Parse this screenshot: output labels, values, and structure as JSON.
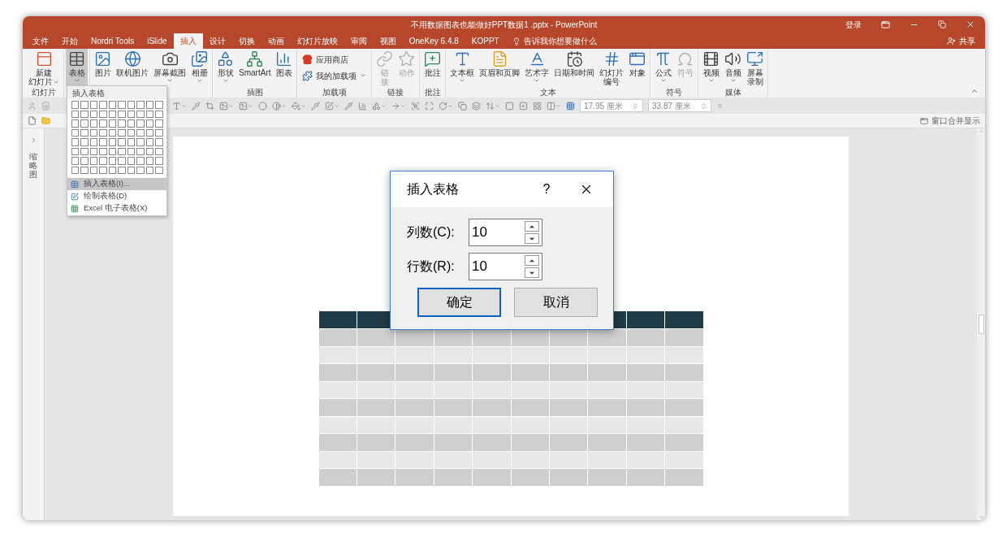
{
  "window": {
    "title": "不用数据图表也能做好PPT数据1 .pptx - PowerPoint",
    "sign_in": "登录",
    "share": "共享"
  },
  "tabs": [
    {
      "label": "文件",
      "selected": false
    },
    {
      "label": "开始",
      "selected": false
    },
    {
      "label": "Nordri Tools",
      "selected": false
    },
    {
      "label": "iSlide",
      "selected": false
    },
    {
      "label": "插入",
      "selected": true
    },
    {
      "label": "设计",
      "selected": false
    },
    {
      "label": "切换",
      "selected": false
    },
    {
      "label": "动画",
      "selected": false
    },
    {
      "label": "幻灯片放映",
      "selected": false
    },
    {
      "label": "审阅",
      "selected": false
    },
    {
      "label": "视图",
      "selected": false
    },
    {
      "label": "OneKey 6.4.8",
      "selected": false
    },
    {
      "label": "KOPPT",
      "selected": false
    }
  ],
  "tell_me": "告诉我你想要做什么",
  "ribbon": {
    "groups": [
      {
        "label": "幻灯片",
        "buttons": [
          {
            "kind": "large",
            "label": "新建",
            "label_2": "幻灯片",
            "menu": true,
            "disabled": false,
            "pressed": false
          }
        ]
      },
      {
        "buttons": [
          {
            "kind": "large",
            "label": "表格",
            "menu": true,
            "disabled": false,
            "pressed": true
          }
        ]
      },
      {
        "buttons": [
          {
            "kind": "large",
            "label": "图片",
            "menu": false,
            "disabled": false,
            "pressed": false
          },
          {
            "kind": "large",
            "label": "联机图片",
            "menu": false,
            "disabled": false,
            "pressed": false
          },
          {
            "kind": "large",
            "label": "屏幕截图",
            "menu": true,
            "disabled": false,
            "pressed": false
          },
          {
            "kind": "large",
            "label": "相册",
            "menu": true,
            "disabled": false,
            "pressed": false
          }
        ]
      },
      {
        "label": "插图",
        "buttons": [
          {
            "kind": "large",
            "label": "形状",
            "menu": true,
            "disabled": false,
            "pressed": false
          },
          {
            "kind": "large",
            "label": "SmartArt",
            "menu": false,
            "disabled": false,
            "pressed": false
          },
          {
            "kind": "large",
            "label": "图表",
            "menu": false,
            "disabled": false,
            "pressed": false
          }
        ]
      },
      {
        "label": "加载项",
        "buttons": [
          {
            "kind": "small",
            "label": "应用商店",
            "menu": false,
            "disabled": false,
            "pressed": false
          },
          {
            "kind": "small",
            "label": "我的加载项",
            "menu": true,
            "disabled": false,
            "pressed": false
          }
        ]
      },
      {
        "label": "链接",
        "buttons": [
          {
            "kind": "large",
            "label": "链",
            "label_2": "接",
            "menu": false,
            "disabled": true,
            "pressed": false
          },
          {
            "kind": "large",
            "label": "动作",
            "menu": false,
            "disabled": true,
            "pressed": false
          }
        ]
      },
      {
        "label": "批注",
        "buttons": [
          {
            "kind": "large",
            "label": "批注",
            "menu": false,
            "disabled": false,
            "pressed": false
          }
        ]
      },
      {
        "label": "文本",
        "buttons": [
          {
            "kind": "large",
            "label": "文本框",
            "menu": true,
            "disabled": false,
            "pressed": false
          },
          {
            "kind": "large",
            "label": "页眉和页脚",
            "menu": false,
            "disabled": false,
            "pressed": false
          },
          {
            "kind": "large",
            "label": "艺术字",
            "menu": true,
            "disabled": false,
            "pressed": false
          },
          {
            "kind": "large",
            "label": "日期和时间",
            "menu": false,
            "disabled": false,
            "pressed": false
          },
          {
            "kind": "large",
            "label": "幻灯片",
            "label_2": "编号",
            "menu": false,
            "disabled": false,
            "pressed": false
          },
          {
            "kind": "large",
            "label": "对象",
            "menu": false,
            "disabled": false,
            "pressed": false
          }
        ]
      },
      {
        "label": "符号",
        "buttons": [
          {
            "kind": "large",
            "label": "公式",
            "menu": true,
            "disabled": false,
            "pressed": false
          },
          {
            "kind": "large",
            "label": "符号",
            "menu": false,
            "disabled": true,
            "pressed": false
          }
        ]
      },
      {
        "label": "媒体",
        "buttons": [
          {
            "kind": "large",
            "label": "视频",
            "menu": true,
            "disabled": false,
            "pressed": false
          },
          {
            "kind": "large",
            "label": "音频",
            "menu": true,
            "disabled": false,
            "pressed": false
          },
          {
            "kind": "large",
            "label": "屏幕",
            "label_2": "录制",
            "menu": false,
            "disabled": false,
            "pressed": false
          }
        ]
      }
    ]
  },
  "toolbar": {
    "width": "17.95 厘米",
    "height": "33.87 厘米"
  },
  "merge_windows": "窗口合并显示",
  "thumbnail_pane": "缩略图",
  "table_menu": {
    "header": "插入表格",
    "items": [
      {
        "label": "插入表格(I)...",
        "selected": true
      },
      {
        "label": "绘制表格(D)",
        "selected": false
      },
      {
        "label": "Excel 电子表格(X)",
        "selected": false
      }
    ]
  },
  "dialog": {
    "title": "插入表格",
    "help": "?",
    "fields": [
      {
        "label": "列数(C):",
        "value": "10"
      },
      {
        "label": "行数(R):",
        "value": "10"
      }
    ],
    "buttons": [
      {
        "label": "确定",
        "default": true
      },
      {
        "label": "取消",
        "default": false
      }
    ]
  }
}
